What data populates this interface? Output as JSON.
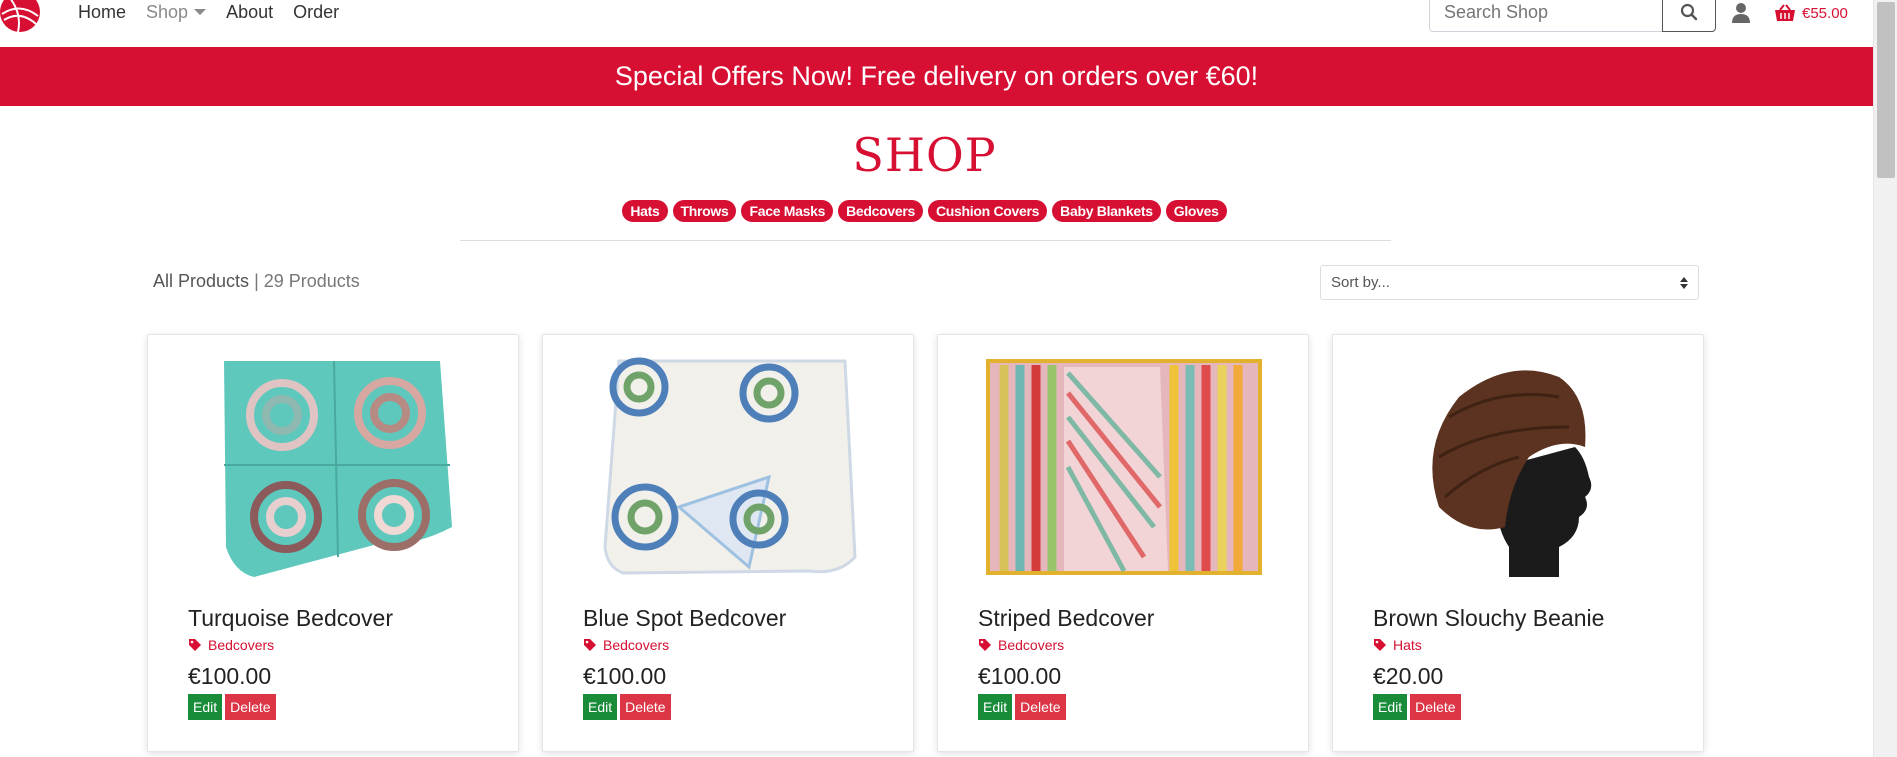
{
  "nav": {
    "home": "Home",
    "shop": "Shop",
    "about": "About",
    "order": "Order",
    "search_placeholder": "Search Shop",
    "basket_total": "€55.00"
  },
  "banner": {
    "text": "Special Offers Now! Free delivery on orders over €60!"
  },
  "shop": {
    "title": "SHOP",
    "categories": [
      "Hats",
      "Throws",
      "Face Masks",
      "Bedcovers",
      "Cushion Covers",
      "Baby Blankets",
      "Gloves"
    ],
    "all_products": "All Products",
    "product_count": "| 29 Products",
    "sort_label": "Sort by..."
  },
  "products": [
    {
      "name": "Turquoise Bedcover",
      "category": "Bedcovers",
      "price": "€100.00",
      "edit": "Edit",
      "delete": "Delete"
    },
    {
      "name": "Blue Spot Bedcover",
      "category": "Bedcovers",
      "price": "€100.00",
      "edit": "Edit",
      "delete": "Delete"
    },
    {
      "name": "Striped Bedcover",
      "category": "Bedcovers",
      "price": "€100.00",
      "edit": "Edit",
      "delete": "Delete"
    },
    {
      "name": "Brown Slouchy Beanie",
      "category": "Hats",
      "price": "€20.00",
      "edit": "Edit",
      "delete": "Delete"
    }
  ],
  "colors": {
    "brand": "#d60f33",
    "edit": "#198c3a",
    "delete": "#dc3545"
  }
}
